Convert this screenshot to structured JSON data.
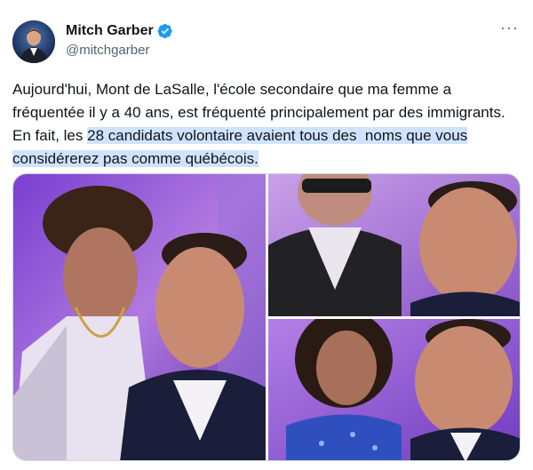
{
  "author": {
    "display_name": "Mitch Garber",
    "handle": "@mitchgarber",
    "verified": true,
    "avatar_icon": "profile-photo"
  },
  "menu": {
    "more_label": "···"
  },
  "tweet": {
    "lines": [
      "Aujourd'hui, Mont de LaSalle, l'école secondaire que ma femme a",
      "fréquentée il y a 40 ans, est fréquenté principalement par des immigrants.",
      "En fait, les ",
      "28 candidats volontaire avaient tous des  noms que vous",
      "considérerez pas comme québécois."
    ]
  },
  "colors": {
    "highlight": "#cfe3ff",
    "verified": "#1d9bf0",
    "handle": "#536471"
  },
  "media": {
    "photos": [
      {
        "name": "selfie-young-man",
        "icon": "photo"
      },
      {
        "name": "selfie-man-glasses",
        "icon": "photo"
      },
      {
        "name": "selfie-girl",
        "icon": "photo"
      }
    ]
  }
}
